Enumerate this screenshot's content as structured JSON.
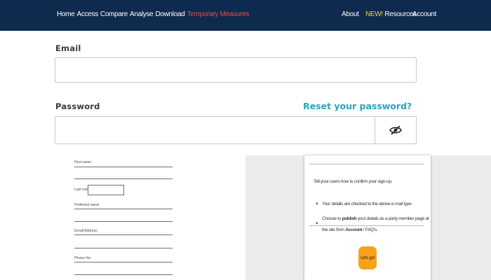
{
  "nav": {
    "left_items": [
      "Home",
      "Access",
      "Compare",
      "Analyse",
      "Download"
    ],
    "temporary": "Temporary Measures",
    "about": "About",
    "new_badge": "NEW!",
    "resources": "Resources",
    "account": "Account"
  },
  "login": {
    "email_label": "Email",
    "password_label": "Password",
    "reset_link": "Reset your password?",
    "show_password_icon": "eye-slash-icon"
  },
  "mini_form": {
    "first_name": "First name",
    "last_name": "Last name",
    "preferred_name": "Preferred name",
    "email_address": "Email Address",
    "phone": "Phone No."
  },
  "dialog": {
    "intro": "Tell your users how to confirm your sign-up.",
    "item1": "Your details are checked to the above e-mail type.",
    "item2_pre": "Choose to ",
    "item2_bold": "publish",
    "item2_post": " your details as a party member page at",
    "item2_line2_pre": "the site from ",
    "item2_line2_bold": "Account",
    "item2_line2_post": " / FAQ's.",
    "button": "Let's go!"
  },
  "colors": {
    "nav_bg": "#0e2a4f",
    "temporary_measures": "#e84b4b",
    "new_badge": "#f2d32b",
    "reset_link": "#26a6b8",
    "orange_button": "#f7a21b"
  }
}
